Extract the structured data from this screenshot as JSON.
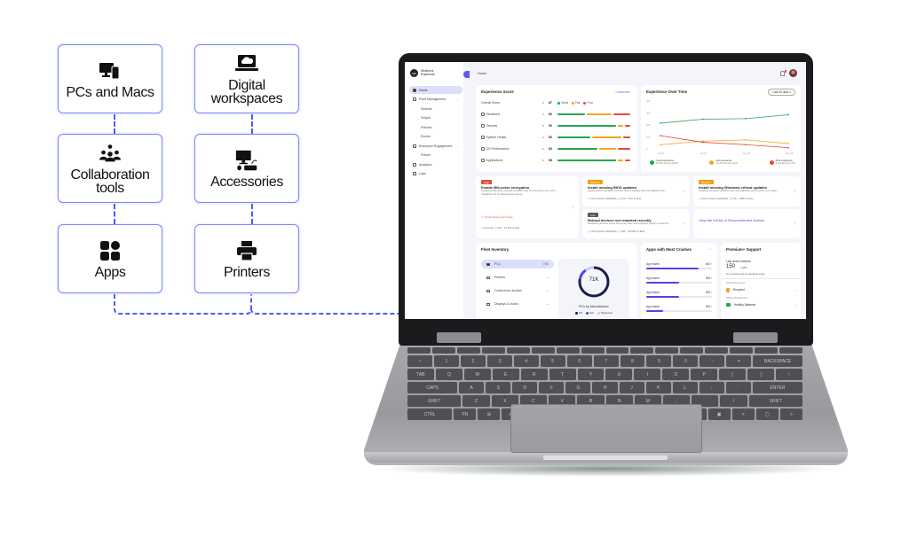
{
  "features": {
    "cards": [
      {
        "label": "PCs and Macs",
        "icon": "devices-icon"
      },
      {
        "label": "Digital workspaces",
        "icon": "cloud-laptop-icon"
      },
      {
        "label": "Collaboration tools",
        "icon": "people-chat-icon"
      },
      {
        "label": "Accessories",
        "icon": "desktop-keyboard-icon"
      },
      {
        "label": "Apps",
        "icon": "apps-grid-icon"
      },
      {
        "label": "Printers",
        "icon": "printer-icon"
      }
    ],
    "connector_color": "#4a5cff",
    "border_color": "#7b86ff"
  },
  "dashboard": {
    "app_name_line1": "Workforce",
    "app_name_line2": "Experience",
    "breadcrumb": "Home",
    "sidebar": {
      "items": [
        {
          "label": "Home",
          "active": true
        },
        {
          "label": "Fleet Management",
          "expandable": true
        },
        {
          "label": "Devices",
          "sub": true
        },
        {
          "label": "Scripts",
          "sub": true
        },
        {
          "label": "Policies",
          "sub": true
        },
        {
          "label": "Events",
          "sub": true
        },
        {
          "label": "Employee Engagement",
          "expandable": true
        },
        {
          "label": "Pulses",
          "sub": true
        },
        {
          "label": "Analytics"
        },
        {
          "label": "Labs"
        }
      ]
    },
    "experience_score": {
      "title": "Experience Score",
      "customize_label": "Customize",
      "legend": [
        {
          "label": "Great",
          "color": "#22a74f"
        },
        {
          "label": "Fair",
          "color": "#f5a524"
        },
        {
          "label": "Poor",
          "color": "#e5483b"
        }
      ],
      "overall": {
        "label": "Overall Score",
        "delta": "↑2",
        "value": "87"
      },
      "rows": [
        {
          "label": "Sentiment",
          "delta": "↓3",
          "value": "80",
          "great": 0.4,
          "fair": 0.35,
          "poor": 0.25
        },
        {
          "label": "Security",
          "delta": "↑5",
          "value": "90",
          "great": 0.84,
          "fair": 0.08,
          "poor": 0.08
        },
        {
          "label": "System Health",
          "delta": "↓2",
          "value": "80",
          "great": 0.47,
          "fair": 0.43,
          "poor": 0.1
        },
        {
          "label": "OS Performance",
          "delta": "↓2",
          "value": "83",
          "great": 0.58,
          "fair": 0.24,
          "poor": 0.18
        },
        {
          "label": "Applications",
          "delta": "↑3",
          "value": "98",
          "great": 0.84,
          "fair": 0.08,
          "poor": 0.08
        }
      ]
    },
    "experience_over_time": {
      "title": "Experience Over Time",
      "range_select": "Last 90 days",
      "chart_data": {
        "type": "line",
        "x": [
          "Jul 15",
          "Jul 27",
          "Aug 15",
          "Sep 15"
        ],
        "ylim": [
          0,
          400
        ],
        "y_ticks": [
          "400",
          "300",
          "200",
          "100",
          "0"
        ],
        "series": [
          {
            "name": "Great experience",
            "color": "#22a74f",
            "values": [
              215,
              248,
              253,
              285
            ]
          },
          {
            "name": "Fair experience",
            "color": "#f5a524",
            "values": [
              35,
              65,
              75,
              45
            ]
          },
          {
            "name": "Poor experience",
            "color": "#e5483b",
            "values": [
              110,
              55,
              35,
              10
            ]
          }
        ]
      },
      "legend": [
        {
          "label": "Great experience",
          "sub": "85,800 devices (85%)",
          "color": "#22a74f",
          "icon": "smile-icon"
        },
        {
          "label": "Fair experience",
          "sub": "10,000 devices (11%)",
          "color": "#f5a524",
          "icon": "neutral-icon"
        },
        {
          "label": "Poor experience",
          "sub": "3,200 devices (3%)",
          "color": "#e5483b",
          "icon": "warning-icon"
        }
      ]
    },
    "recommendations": [
      {
        "badge": "High",
        "badge_color": "#e5483b",
        "title": "Enable BitLocker encryption",
        "desc": "Activating BitLocker protects sensitive data by encrypting your drive, mitigating risk of unauthorized access",
        "trend": "+5.1% devices last 7 days",
        "meta1": "Security",
        "meta2": "9.5K · 12.5% of fleet"
      },
      {
        "badge": "Medium",
        "badge_color": "#f59e0b",
        "title": "Install missing BIOS updates",
        "desc": "Applying BIOS updates ensures system stability and compatibility with...",
        "meta1": "OS & System Reliability",
        "meta2": "9.1K · 64% of fleet"
      },
      {
        "badge": "Medium",
        "badge_color": "#f59e0b",
        "title": "Install missing Windows critical updates",
        "desc": "Installing the latest updates fixes vulnerabilities and ensures your syste...",
        "meta1": "OS & System Reliability",
        "meta2": "4.1K · 100% of fleet"
      },
      {
        "badge": "Low",
        "badge_color": "#555555",
        "title": "Reboot devices not restarted recently",
        "desc": "Restarting devices clears temporary files and refreshes system resources...",
        "meta1": "OS & System Reliability",
        "meta2": "4.6K · 60.65% of fleet"
      },
      {
        "link": "View the full list of Recommended Actions"
      }
    ],
    "fleet_inventory": {
      "title": "Fleet Inventory",
      "items": [
        {
          "label": "PCs",
          "count": "71K",
          "active": true,
          "icon": "pc-icon"
        },
        {
          "label": "Printers",
          "count": "",
          "icon": "printer-icon"
        },
        {
          "label": "Conference devices",
          "count": "",
          "icon": "conference-icon"
        },
        {
          "label": "Displays & docks",
          "count": "",
          "icon": "display-icon"
        }
      ],
      "donut": {
        "center_label": "71K",
        "caption": "PCs by Manufacturer",
        "segments": [
          {
            "name": "HP",
            "fraction": 0.78,
            "color": "#1e1b4b"
          },
          {
            "name": "Dell",
            "fraction": 0.12,
            "color": "#4f46e5"
          },
          {
            "name": "Panasonic",
            "fraction": 0.1,
            "color": "#c7c9f5"
          }
        ]
      }
    },
    "crashes": {
      "title": "Apps with Most Crashes",
      "rows": [
        {
          "label": "App Name",
          "value": "400",
          "fraction": 0.8
        },
        {
          "label": "App Name",
          "value": "250",
          "fraction": 0.5
        },
        {
          "label": "App Name",
          "value": "250",
          "fraction": 0.5
        },
        {
          "label": "App Name",
          "value": "200",
          "fraction": 0.25
        }
      ]
    },
    "premium_support": {
      "title": "Premium+ Support",
      "incidents_label": "Last week incidents",
      "incidents_value": "150",
      "incidents_delta": "↘ 38%",
      "incidents_note": "No critical incidents identified today",
      "disk_label": "Disk Replacement",
      "disk_status": "Required",
      "battery_label": "Battery Replacement",
      "battery_status": "Healthy Batteries"
    }
  }
}
